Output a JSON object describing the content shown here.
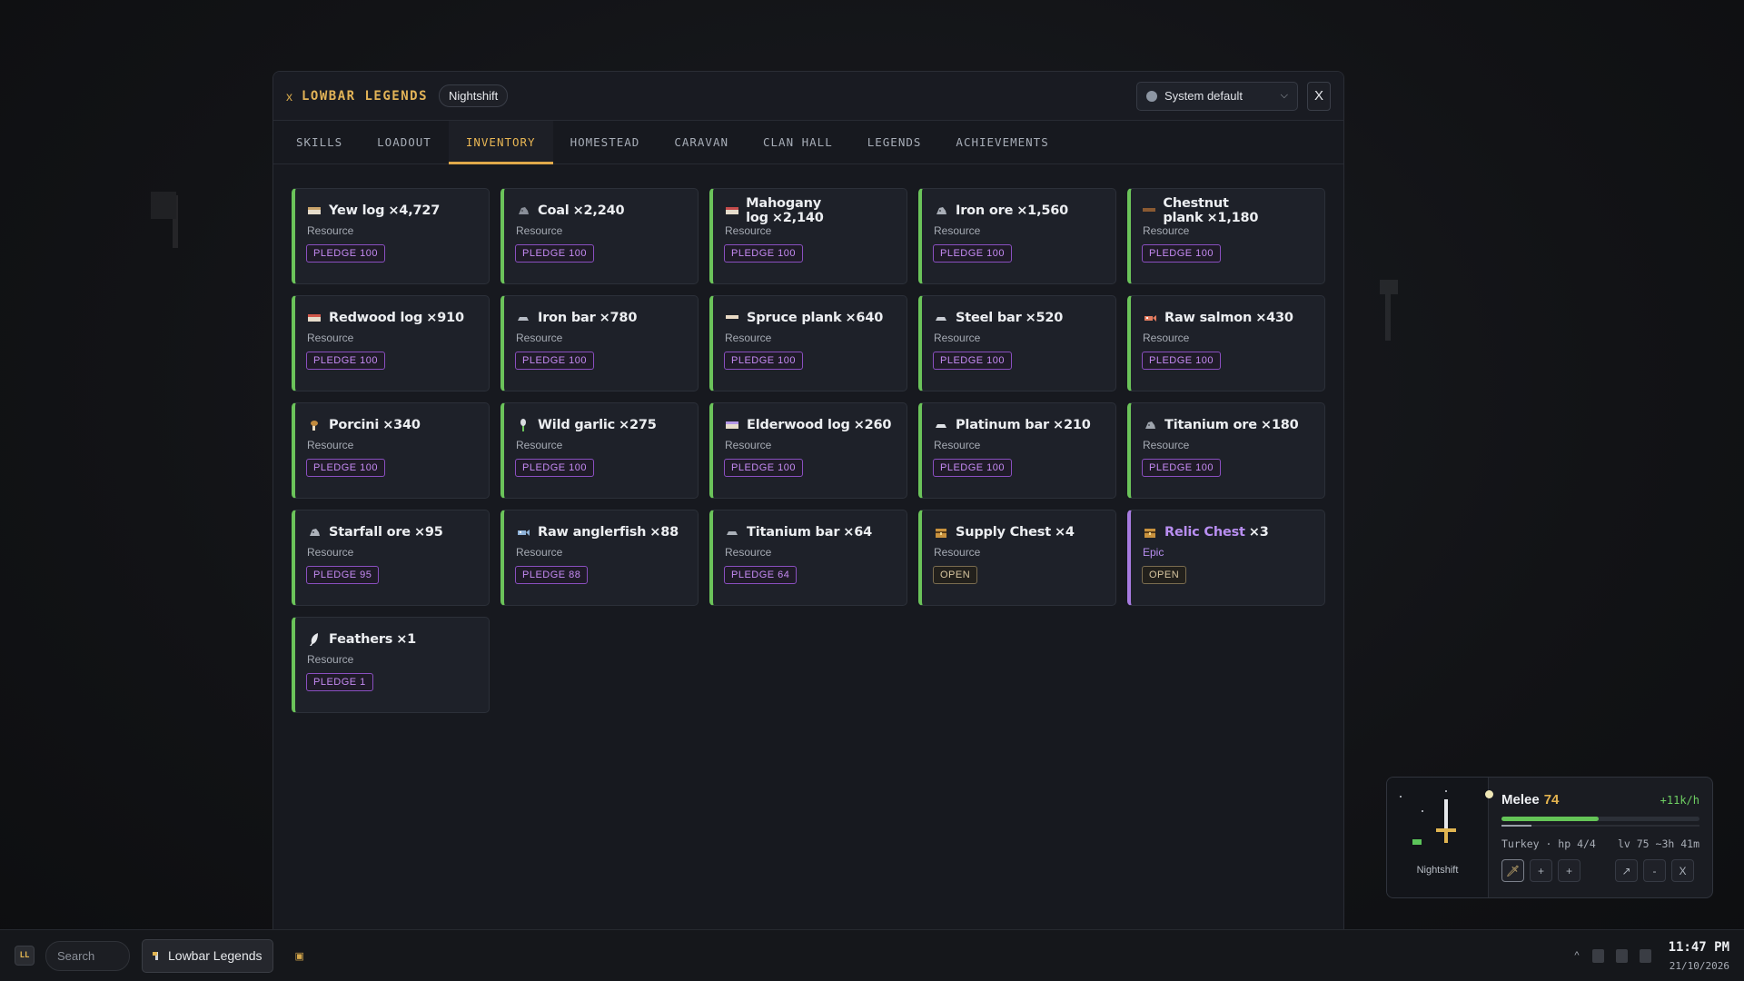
{
  "window": {
    "title_prefix": "x",
    "title": "LOWBAR LEGENDS",
    "profile": "Nightshift",
    "theme": "System default",
    "close": "X"
  },
  "tabs": [
    {
      "label": "SKILLS"
    },
    {
      "label": "LOADOUT"
    },
    {
      "label": "INVENTORY",
      "active": true
    },
    {
      "label": "HOMESTEAD"
    },
    {
      "label": "CARAVAN"
    },
    {
      "label": "CLAN HALL"
    },
    {
      "label": "LEGENDS"
    },
    {
      "label": "ACHIEVEMENTS"
    }
  ],
  "items": [
    {
      "name": "Yew log",
      "qty": "×4,727",
      "type": "Resource",
      "action": "PLEDGE 100",
      "icon": "log-icon",
      "color": "#c9a36a"
    },
    {
      "name": "Coal",
      "qty": "×2,240",
      "type": "Resource",
      "action": "PLEDGE 100",
      "icon": "ore-icon",
      "color": "#8a8f99"
    },
    {
      "name": "Mahogany log",
      "qty": "×2,140",
      "type": "Resource",
      "action": "PLEDGE 100",
      "icon": "log-icon",
      "color": "#c44b4b"
    },
    {
      "name": "Iron ore",
      "qty": "×1,560",
      "type": "Resource",
      "action": "PLEDGE 100",
      "icon": "ore-icon",
      "color": "#a9aeb7"
    },
    {
      "name": "Chestnut plank",
      "qty": "×1,180",
      "type": "Resource",
      "action": "PLEDGE 100",
      "icon": "plank-icon",
      "color": "#8a5a32"
    },
    {
      "name": "Redwood log",
      "qty": "×910",
      "type": "Resource",
      "action": "PLEDGE 100",
      "icon": "log-icon",
      "color": "#d0574a"
    },
    {
      "name": "Iron bar",
      "qty": "×780",
      "type": "Resource",
      "action": "PLEDGE 100",
      "icon": "bar-icon",
      "color": "#b6bbc4"
    },
    {
      "name": "Spruce plank",
      "qty": "×640",
      "type": "Resource",
      "action": "PLEDGE 100",
      "icon": "plank-icon",
      "color": "#e8d9c4"
    },
    {
      "name": "Steel bar",
      "qty": "×520",
      "type": "Resource",
      "action": "PLEDGE 100",
      "icon": "bar-icon",
      "color": "#c8ccd3"
    },
    {
      "name": "Raw salmon",
      "qty": "×430",
      "type": "Resource",
      "action": "PLEDGE 100",
      "icon": "fish-icon",
      "color": "#e07a5f"
    },
    {
      "name": "Porcini",
      "qty": "×340",
      "type": "Resource",
      "action": "PLEDGE 100",
      "icon": "mushroom-icon",
      "color": "#c08a3e"
    },
    {
      "name": "Wild garlic",
      "qty": "×275",
      "type": "Resource",
      "action": "PLEDGE 100",
      "icon": "herb-icon",
      "color": "#d9dce0"
    },
    {
      "name": "Elderwood log",
      "qty": "×260",
      "type": "Resource",
      "action": "PLEDGE 100",
      "icon": "log-icon",
      "color": "#b497e6"
    },
    {
      "name": "Platinum bar",
      "qty": "×210",
      "type": "Resource",
      "action": "PLEDGE 100",
      "icon": "bar-icon",
      "color": "#dfe2e6"
    },
    {
      "name": "Titanium ore",
      "qty": "×180",
      "type": "Resource",
      "action": "PLEDGE 100",
      "icon": "ore-icon",
      "color": "#9ea4ad"
    },
    {
      "name": "Starfall ore",
      "qty": "×95",
      "type": "Resource",
      "action": "PLEDGE 95",
      "icon": "ore-icon",
      "color": "#aeb3bc"
    },
    {
      "name": "Raw anglerfish",
      "qty": "×88",
      "type": "Resource",
      "action": "PLEDGE 88",
      "icon": "fish-icon",
      "color": "#8fb3d9"
    },
    {
      "name": "Titanium bar",
      "qty": "×64",
      "type": "Resource",
      "action": "PLEDGE 64",
      "icon": "bar-icon",
      "color": "#aab0b8"
    },
    {
      "name": "Supply Chest",
      "qty": "×4",
      "type": "Resource",
      "action": "OPEN",
      "icon": "chest-icon",
      "color": "#c9923e"
    },
    {
      "name": "Relic Chest",
      "qty": "×3",
      "type": "Epic",
      "action": "OPEN",
      "icon": "chest-icon",
      "color": "#c9923e",
      "epic": true
    },
    {
      "name": "Feathers",
      "qty": "×1",
      "type": "Resource",
      "action": "PLEDGE 1",
      "icon": "feather-icon",
      "color": "#e6e8eb"
    }
  ],
  "widget": {
    "character": "Nightshift",
    "skill": "Melee",
    "level": "74",
    "rate": "+11k/h",
    "progress": 0.49,
    "sub_progress": 0.15,
    "food": "Turkey · hp 4/4",
    "eta": "lv 75 ~3h 41m",
    "buttons": [
      "🗡",
      "+",
      "+",
      "↗",
      "-",
      "X"
    ]
  },
  "taskbar": {
    "logo": "LL",
    "search_placeholder": "Search",
    "app": "Lowbar Legends",
    "time": "11:47 PM",
    "date": "21/10/2026"
  },
  "colors": {
    "accent": "#e0a94a",
    "resource_border": "#6bc35a",
    "epic": "#b88ef0",
    "pledge": "#c58af3"
  }
}
